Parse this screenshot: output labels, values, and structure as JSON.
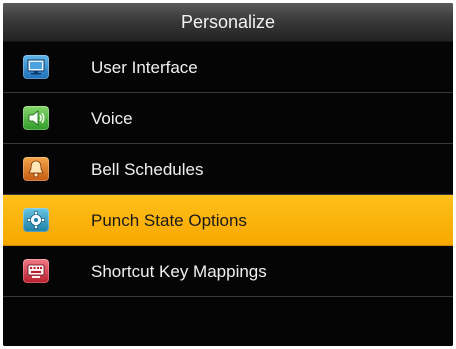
{
  "header": {
    "title": "Personalize"
  },
  "menu": {
    "items": [
      {
        "label": "User Interface",
        "icon": "monitor-icon",
        "selected": false
      },
      {
        "label": "Voice",
        "icon": "speaker-icon",
        "selected": false
      },
      {
        "label": "Bell Schedules",
        "icon": "bell-icon",
        "selected": false
      },
      {
        "label": "Punch State Options",
        "icon": "gear-icon",
        "selected": true
      },
      {
        "label": "Shortcut Key Mappings",
        "icon": "keyboard-icon",
        "selected": false
      }
    ]
  },
  "colors": {
    "background": "#050505",
    "selected_row": "#f9b200",
    "text": "#f0f0f0",
    "selected_text": "#1a1a1a"
  }
}
